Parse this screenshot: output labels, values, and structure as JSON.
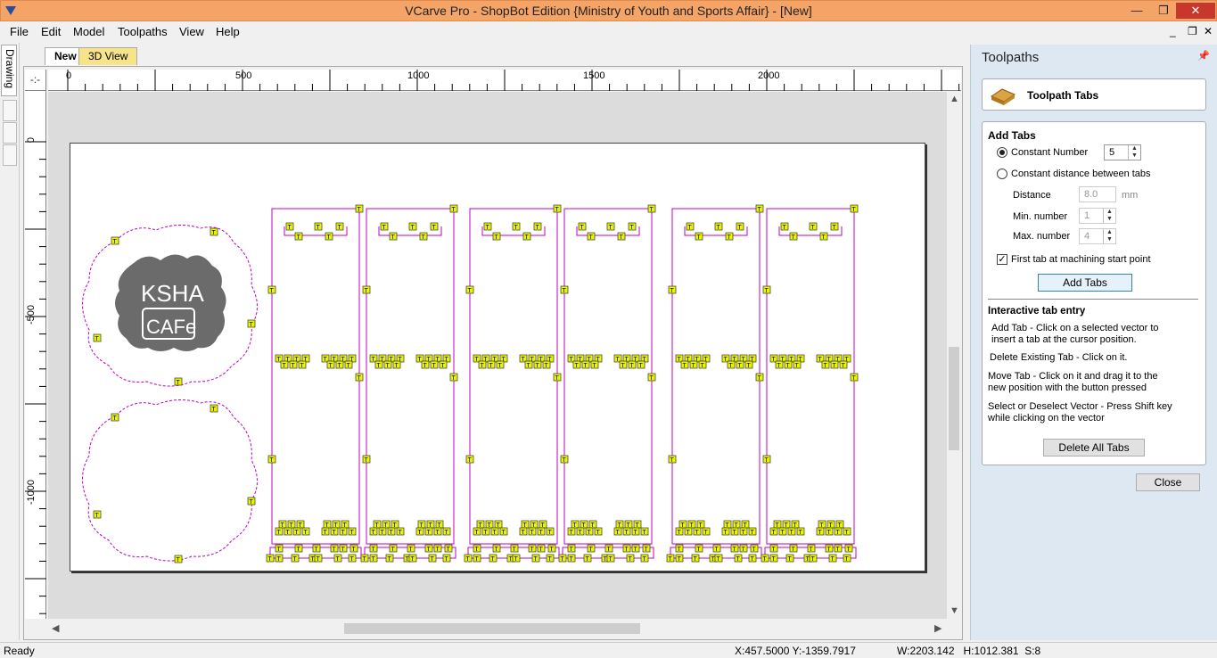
{
  "window": {
    "title": "VCarve Pro - ShopBot Edition {Ministry of Youth and Sports Affair} - [New]",
    "minimize": "—",
    "restore": "❐",
    "close": "✕"
  },
  "menu": {
    "items": [
      "File",
      "Edit",
      "Model",
      "Toolpaths",
      "View",
      "Help"
    ],
    "mdi_minimize": "_",
    "mdi_restore": "❐",
    "mdi_close": "✕"
  },
  "sidebar": {
    "drawing_tab": "Drawing"
  },
  "doc_tabs": {
    "new": "New",
    "view3d": "3D View"
  },
  "ruler": {
    "corner": "-:-",
    "h_labels": [
      "0",
      "500",
      "1000",
      "1500",
      "2000"
    ],
    "v_labels": [
      "0",
      "-500",
      "-1000"
    ]
  },
  "logo": {
    "line1": "KSHA",
    "line2": "CAFe"
  },
  "tab_marker": "T",
  "panel": {
    "title": "Toolpaths",
    "pin": "📌",
    "header": "Toolpath Tabs",
    "add_tabs_heading": "Add Tabs",
    "constant_number_label": "Constant Number",
    "constant_number_value": "5",
    "constant_distance_label": "Constant distance between tabs",
    "distance_label": "Distance",
    "distance_value": "8.0",
    "distance_unit": "mm",
    "min_number_label": "Min. number",
    "min_number_value": "1",
    "max_number_label": "Max. number",
    "max_number_value": "4",
    "first_tab_label": "First tab at machining start point",
    "add_tabs_button": "Add Tabs",
    "interactive_heading": "Interactive tab entry",
    "help_add_1": "Add Tab - Click on a selected vector to",
    "help_add_2": "insert a tab at the cursor position.",
    "help_delete": "Delete Existing Tab - Click on it.",
    "help_move_1": "Move Tab - Click on it and drag it to the",
    "help_move_2": "new position with the button pressed",
    "help_select_1": "Select or Deselect Vector - Press Shift key",
    "help_select_2": "while clicking on the vector",
    "delete_all_button": "Delete All Tabs",
    "close_button": "Close"
  },
  "status": {
    "ready": "Ready",
    "coords": "X:457.5000 Y:-1359.7917",
    "dims": "W:2203.142   H:1012.381  S:8"
  },
  "colors": {
    "title_bar": "#f4a467",
    "vector_outline": "#c000c0",
    "tab_fill": "#e8f400",
    "panel_bg": "#dde8f3"
  }
}
